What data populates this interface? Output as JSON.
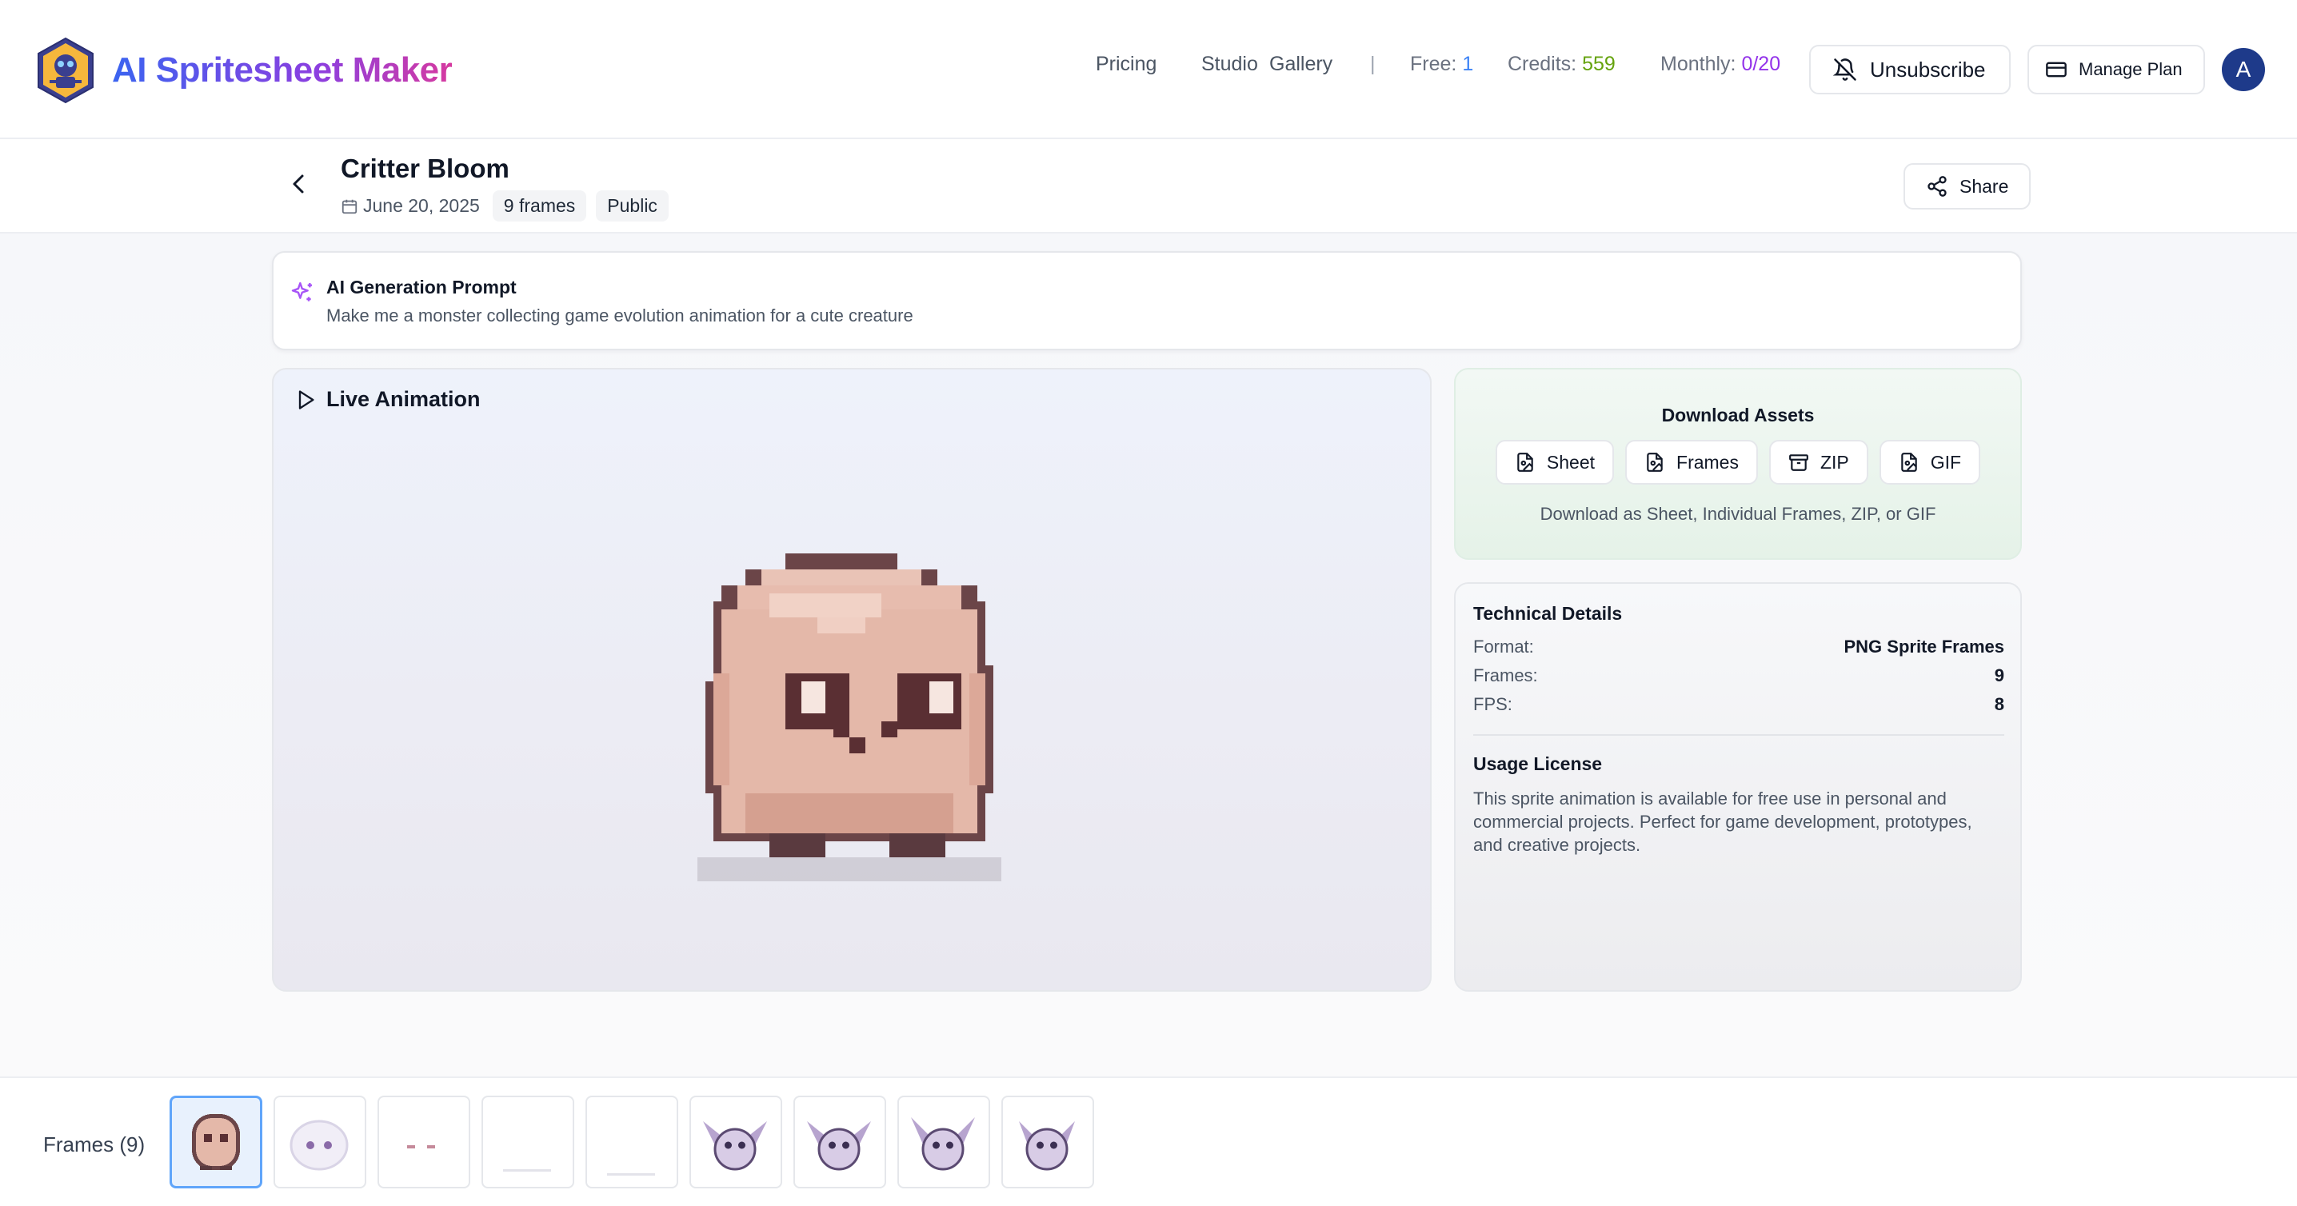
{
  "header": {
    "brand": "AI Spritesheet Maker",
    "nav": [
      "Pricing",
      "Studio",
      "Gallery"
    ],
    "divider": "|",
    "free_label": "Free:",
    "free_value": "1",
    "credits_label": "Credits:",
    "credits_value": "559",
    "monthly_label": "Monthly:",
    "monthly_value": "0/20",
    "unsubscribe": "Unsubscribe",
    "manage_plan": "Manage Plan",
    "avatar_initial": "A"
  },
  "colors": {
    "free": "#3b82f6",
    "credits": "#65a30d",
    "monthly": "#9333ea",
    "sparkle": "#a855f7"
  },
  "sprite": {
    "title": "Critter Bloom",
    "date": "June 20, 2025",
    "frames_chip": "9 frames",
    "visibility": "Public",
    "share": "Share"
  },
  "prompt": {
    "title": "AI Generation Prompt",
    "text": "Make me a monster collecting game evolution animation for a cute creature"
  },
  "animation": {
    "title": "Live Animation"
  },
  "downloads": {
    "title": "Download Assets",
    "buttons": [
      "Sheet",
      "Frames",
      "ZIP",
      "GIF"
    ],
    "description": "Download as Sheet, Individual Frames, ZIP, or GIF"
  },
  "technical": {
    "title": "Technical Details",
    "rows": [
      {
        "k": "Format:",
        "v": "PNG Sprite Frames"
      },
      {
        "k": "Frames:",
        "v": "9"
      },
      {
        "k": "FPS:",
        "v": "8"
      }
    ],
    "license_title": "Usage License",
    "license_text": "This sprite animation is available for free use in personal and commercial projects. Perfect for game development, prototypes, and creative projects."
  },
  "frames_bar": {
    "label": "Frames (9)",
    "count": 9,
    "active_index": 0
  }
}
